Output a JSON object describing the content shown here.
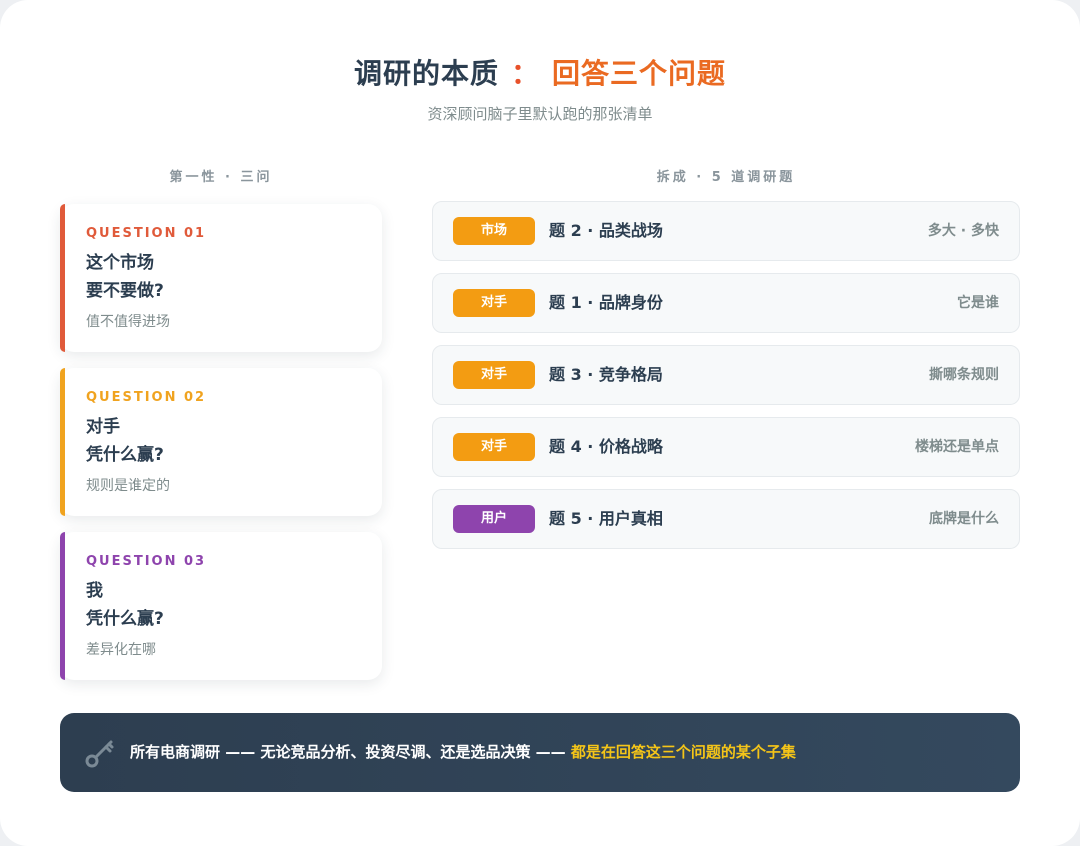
{
  "header": {
    "title_main": "调研的本质",
    "title_sep": "：",
    "title_accent": "回答三个问题",
    "subtitle": "资深顾问脑子里默认跑的那张清单"
  },
  "columns": {
    "left_head": "第一性 · 三问",
    "right_head": "拆成 · 5 道调研题"
  },
  "questions": [
    {
      "tag": "QUESTION 01",
      "line1": "这个市场",
      "line2": "要不要做?",
      "sub": "值不值得进场",
      "color": "#e05a3a"
    },
    {
      "tag": "QUESTION 02",
      "line1": "对手",
      "line2": "凭什么赢?",
      "sub": "规则是谁定的",
      "color": "#f0a31f"
    },
    {
      "tag": "QUESTION 03",
      "line1": "我",
      "line2": "凭什么赢?",
      "sub": "差异化在哪",
      "color": "#8e44ad"
    }
  ],
  "topics": [
    {
      "badge": "市场",
      "title": "题 2 · 品类战场",
      "note": "多大 · 多快",
      "color": "#f39c12"
    },
    {
      "badge": "对手",
      "title": "题 1 · 品牌身份",
      "note": "它是谁",
      "color": "#f39c12"
    },
    {
      "badge": "对手",
      "title": "题 3 · 竞争格局",
      "note": "撕哪条规则",
      "color": "#f39c12"
    },
    {
      "badge": "对手",
      "title": "题 4 · 价格战略",
      "note": "楼梯还是单点",
      "color": "#f39c12"
    },
    {
      "badge": "用户",
      "title": "题 5 · 用户真相",
      "note": "底牌是什么",
      "color": "#8e44ad"
    }
  ],
  "footer": {
    "icon": "key-icon",
    "text": "所有电商调研 —— 无论竞品分析、投资尽调、还是选品决策 —— ",
    "highlight": "都是在回答这三个问题的某个子集"
  }
}
